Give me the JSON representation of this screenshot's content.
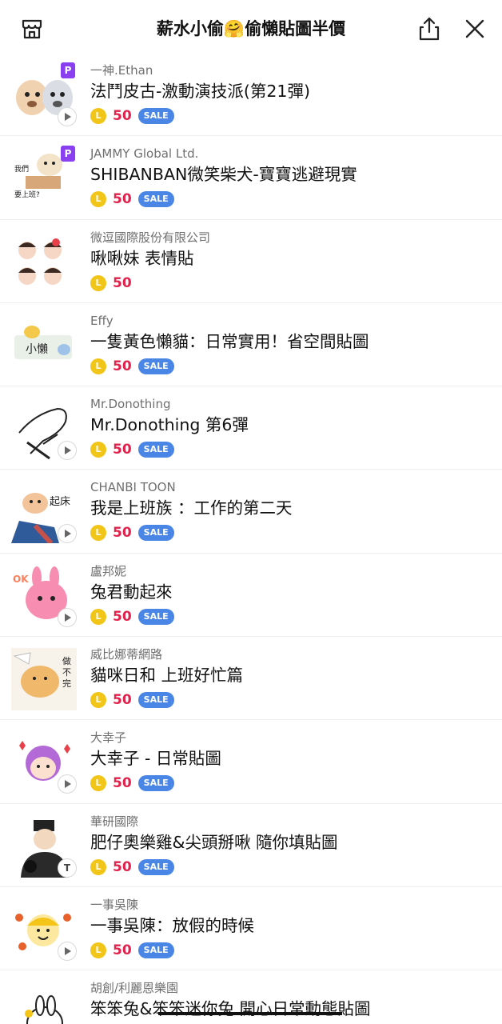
{
  "header": {
    "title": "薪水小偷🤗偷懶貼圖半價",
    "icons": {
      "left": "store-icon",
      "share": "share-icon",
      "close": "close-icon"
    }
  },
  "currency_label": "L",
  "sale_label": "SALE",
  "colors": {
    "price": "#e0224c",
    "sale_badge": "#4a86e6",
    "coin": "#f2c519",
    "premium_badge": "#8a3ff0"
  },
  "items": [
    {
      "author": "一神.Ethan",
      "name": "法鬥皮古-激動演技派(第21彈)",
      "price": "50",
      "sale": true,
      "premium": "P",
      "badge": "play"
    },
    {
      "author": "JAMMY Global Ltd.",
      "name": "SHIBANBAN微笑柴犬-寶寶逃避現實",
      "price": "50",
      "sale": true,
      "premium": "P",
      "badge": "none"
    },
    {
      "author": "微逗國際股份有限公司",
      "name": "啾啾妹 表情貼",
      "price": "50",
      "sale": false,
      "premium": "",
      "badge": "none"
    },
    {
      "author": "Effy",
      "name": "一隻黃色懶貓：日常實用！省空間貼圖",
      "price": "50",
      "sale": true,
      "premium": "",
      "badge": "none"
    },
    {
      "author": "Mr.Donothing",
      "name": "Mr.Donothing 第6彈",
      "price": "50",
      "sale": true,
      "premium": "",
      "badge": "play"
    },
    {
      "author": "CHANBI TOON",
      "name": "我是上班族 ：工作的第二天",
      "price": "50",
      "sale": true,
      "premium": "",
      "badge": "play"
    },
    {
      "author": "盧邦妮",
      "name": "兔君動起來",
      "price": "50",
      "sale": true,
      "premium": "",
      "badge": "play"
    },
    {
      "author": "威比娜蒂網路",
      "name": "貓咪日和 上班好忙篇",
      "price": "50",
      "sale": true,
      "premium": "",
      "badge": "none"
    },
    {
      "author": "大幸子",
      "name": "大幸子 - 日常貼圖",
      "price": "50",
      "sale": true,
      "premium": "",
      "badge": "play"
    },
    {
      "author": "華研國際",
      "name": "肥仔奧樂雞&尖頭掰啾 隨你填貼圖",
      "price": "50",
      "sale": true,
      "premium": "",
      "badge": "T"
    },
    {
      "author": "一事吳陳",
      "name": "一事吳陳：放假的時候",
      "price": "50",
      "sale": true,
      "premium": "",
      "badge": "play"
    },
    {
      "author": "胡創/利麗恩樂園",
      "name": "笨笨兔&笨笨迷你兔 開心日常動態貼圖",
      "price": "",
      "sale": false,
      "premium": "",
      "badge": "none"
    }
  ]
}
